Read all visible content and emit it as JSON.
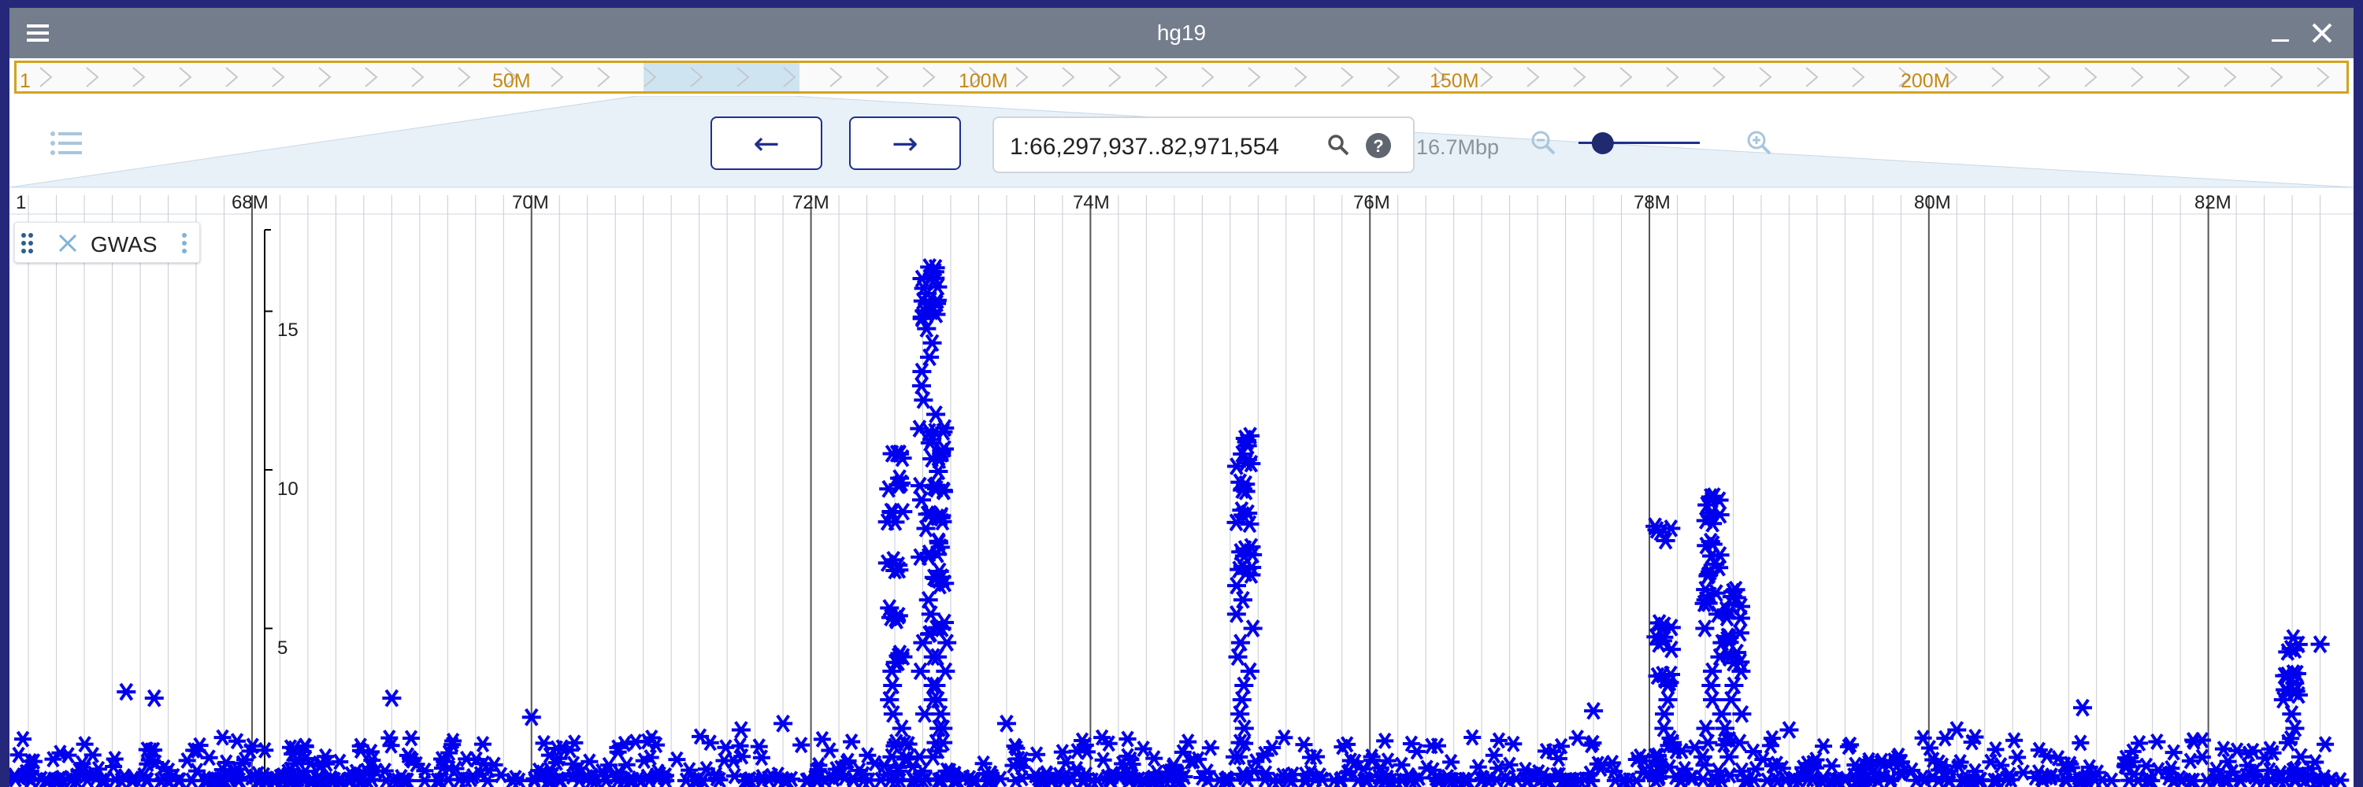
{
  "window": {
    "title": "hg19"
  },
  "overview": {
    "start_label": "1",
    "labels": [
      "50M",
      "100M",
      "150M",
      "200M"
    ],
    "label_positions_bp": [
      50000000,
      100000000,
      150000000,
      200000000
    ],
    "chromosome_length_bp": 249250621,
    "highlight_start_bp": 66297937,
    "highlight_end_bp": 82971554
  },
  "navigation": {
    "back_label": "←",
    "forward_label": "→",
    "location_value": "1:66,297,937..82,971,554",
    "bp_width": "16.7Mbp",
    "zoom_level": 0.2
  },
  "ruler": {
    "start_label": "1",
    "major_ticks": [
      "68M",
      "70M",
      "72M",
      "74M",
      "76M",
      "78M",
      "80M",
      "82M"
    ]
  },
  "track": {
    "name": "GWAS",
    "y_ticks": [
      "5",
      "10",
      "15"
    ]
  },
  "chart_data": {
    "type": "scatter",
    "marker": "asterisk",
    "color": "#0000ee",
    "x_unit": "Mbp",
    "xlim": [
      66.297937,
      82.971554
    ],
    "ylim": [
      0,
      18
    ],
    "x_ticks": [
      "68M",
      "70M",
      "72M",
      "74M",
      "76M",
      "78M",
      "80M",
      "82M"
    ],
    "y_ticks": [
      "5",
      "10",
      "15"
    ],
    "clusters": [
      {
        "x": 72.6,
        "y": [
          4.0,
          5.5,
          7.0,
          8.5,
          9.5,
          10.5
        ]
      },
      {
        "x": 72.85,
        "y": [
          15.2,
          15.8,
          16.2,
          15.0
        ]
      },
      {
        "x": 72.9,
        "y": [
          5.0,
          6.5,
          7.5,
          8.5,
          9.5,
          10.5,
          11.2
        ]
      },
      {
        "x": 75.1,
        "y": [
          6.8,
          7.5,
          8.5,
          9.5,
          10.3,
          10.9
        ]
      },
      {
        "x": 78.1,
        "y": [
          3.5,
          4.5,
          5.0,
          8.0
        ]
      },
      {
        "x": 78.45,
        "y": [
          6.0,
          6.8,
          7.5,
          8.5,
          9.0
        ]
      },
      {
        "x": 78.6,
        "y": [
          4.0,
          4.8,
          5.5,
          6.0
        ]
      },
      {
        "x": 82.6,
        "y": [
          3.0,
          3.5,
          4.5
        ]
      }
    ],
    "isolated_points": [
      {
        "x": 67.1,
        "y": 3.0
      },
      {
        "x": 67.3,
        "y": 2.8
      },
      {
        "x": 69.0,
        "y": 2.8
      },
      {
        "x": 70.0,
        "y": 2.2
      },
      {
        "x": 71.5,
        "y": 1.8
      },
      {
        "x": 71.8,
        "y": 2.0
      },
      {
        "x": 73.4,
        "y": 2.0
      },
      {
        "x": 77.6,
        "y": 2.4
      },
      {
        "x": 79.0,
        "y": 1.8
      },
      {
        "x": 80.2,
        "y": 1.8
      },
      {
        "x": 81.1,
        "y": 2.5
      },
      {
        "x": 82.8,
        "y": 4.5
      }
    ]
  }
}
